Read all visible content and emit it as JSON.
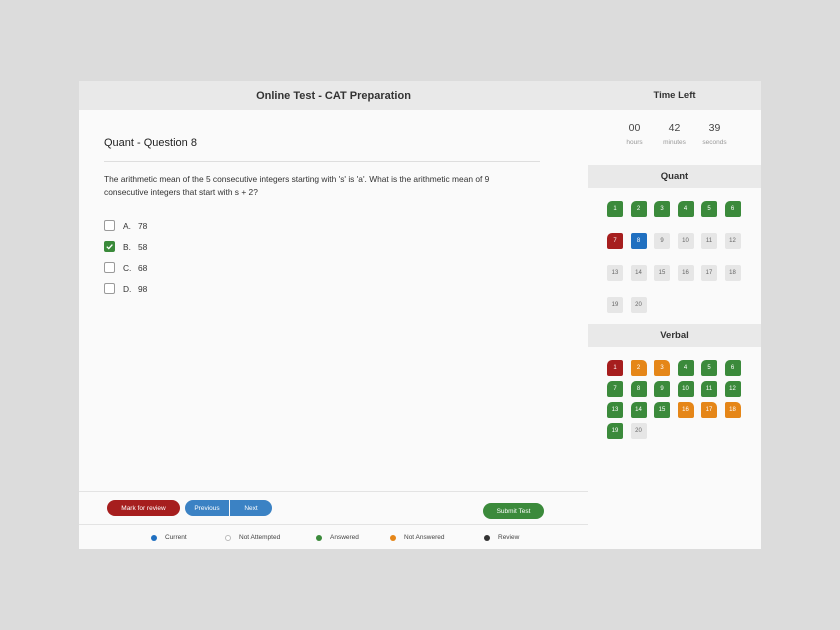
{
  "left": {
    "header_title": "Online Test - CAT Preparation",
    "question_title": "Quant - Question 8",
    "question_text": "The arithmetic mean of the 5 consecutive integers starting with 's' is 'a'. What is the arithmetic mean of 9 consecutive integers that start with s + 2?",
    "options": [
      {
        "letter": "A.",
        "text": "78",
        "checked": false
      },
      {
        "letter": "B.",
        "text": "58",
        "checked": true
      },
      {
        "letter": "C.",
        "text": "68",
        "checked": false
      },
      {
        "letter": "D.",
        "text": "98",
        "checked": false
      }
    ]
  },
  "footer": {
    "mark_review_label": "Mark for review",
    "previous_label": "Previous",
    "next_label": "Next",
    "submit_label": "Submit Test"
  },
  "legend": [
    {
      "label": "Current",
      "color": "#1f6fc0"
    },
    {
      "label": "Not Attempted",
      "color": "#ffffff"
    },
    {
      "label": "Answered",
      "color": "#3b8a3b"
    },
    {
      "label": "Not Answered",
      "color": "#e58618"
    },
    {
      "label": "Review",
      "color": "#333333"
    }
  ],
  "timer": {
    "title": "Time Left",
    "hours": "00",
    "hours_label": "hours",
    "minutes": "42",
    "minutes_label": "minutes",
    "seconds": "39",
    "seconds_label": "seconds"
  },
  "quant": {
    "title": "Quant",
    "cells": [
      {
        "n": "1",
        "s": "answered"
      },
      {
        "n": "2",
        "s": "answered"
      },
      {
        "n": "3",
        "s": "answered"
      },
      {
        "n": "4",
        "s": "answered"
      },
      {
        "n": "5",
        "s": "answered"
      },
      {
        "n": "6",
        "s": "answered"
      },
      {
        "n": "7",
        "s": "review"
      },
      {
        "n": "8",
        "s": "current"
      },
      {
        "n": "9",
        "s": "not-attempted"
      },
      {
        "n": "10",
        "s": "not-attempted"
      },
      {
        "n": "11",
        "s": "not-attempted"
      },
      {
        "n": "12",
        "s": "not-attempted"
      },
      {
        "n": "13",
        "s": "not-attempted"
      },
      {
        "n": "14",
        "s": "not-attempted"
      },
      {
        "n": "15",
        "s": "not-attempted"
      },
      {
        "n": "16",
        "s": "not-attempted"
      },
      {
        "n": "17",
        "s": "not-attempted"
      },
      {
        "n": "18",
        "s": "not-attempted"
      },
      {
        "n": "19",
        "s": "not-attempted"
      },
      {
        "n": "20",
        "s": "not-attempted"
      }
    ]
  },
  "verbal": {
    "title": "Verbal",
    "cells": [
      {
        "n": "1",
        "s": "review"
      },
      {
        "n": "2",
        "s": "not-answered"
      },
      {
        "n": "3",
        "s": "not-answered"
      },
      {
        "n": "4",
        "s": "answered"
      },
      {
        "n": "5",
        "s": "answered"
      },
      {
        "n": "6",
        "s": "answered"
      },
      {
        "n": "7",
        "s": "answered"
      },
      {
        "n": "8",
        "s": "answered"
      },
      {
        "n": "9",
        "s": "answered"
      },
      {
        "n": "10",
        "s": "answered"
      },
      {
        "n": "11",
        "s": "answered"
      },
      {
        "n": "12",
        "s": "answered"
      },
      {
        "n": "13",
        "s": "answered"
      },
      {
        "n": "14",
        "s": "answered"
      },
      {
        "n": "15",
        "s": "answered"
      },
      {
        "n": "16",
        "s": "not-answered"
      },
      {
        "n": "17",
        "s": "not-answered"
      },
      {
        "n": "18",
        "s": "not-answered"
      },
      {
        "n": "19",
        "s": "answered"
      },
      {
        "n": "20",
        "s": "not-attempted"
      }
    ]
  }
}
